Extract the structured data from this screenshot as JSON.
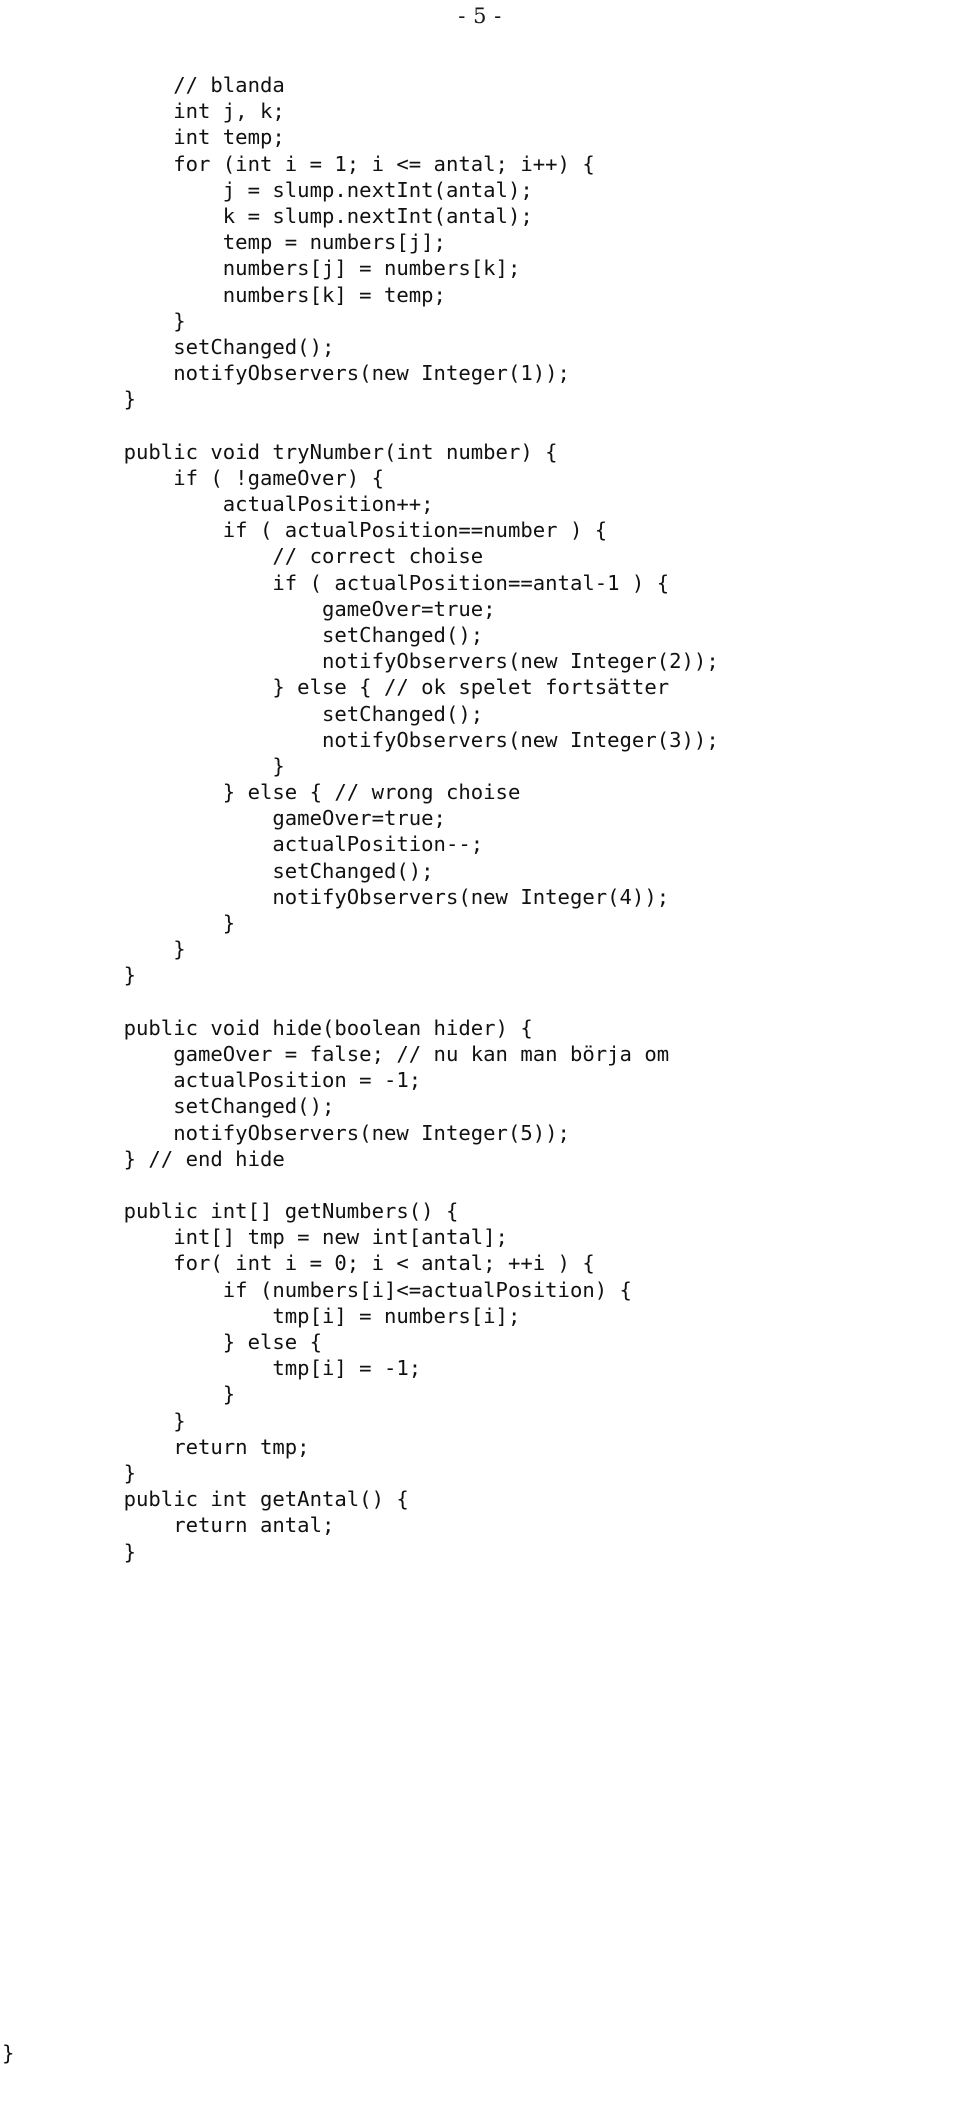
{
  "document": {
    "page_header": "- 5 -",
    "language": "java",
    "final_brace": "}"
  },
  "code": {
    "lines": [
      "        // blanda",
      "        int j, k;",
      "        int temp;",
      "        for (int i = 1; i <= antal; i++) {",
      "            j = slump.nextInt(antal);",
      "            k = slump.nextInt(antal);",
      "            temp = numbers[j];",
      "            numbers[j] = numbers[k];",
      "            numbers[k] = temp;",
      "        }",
      "        setChanged();",
      "        notifyObservers(new Integer(1));",
      "    }",
      "",
      "    public void tryNumber(int number) {",
      "        if ( !gameOver) {",
      "            actualPosition++;",
      "            if ( actualPosition==number ) {",
      "                // correct choise",
      "                if ( actualPosition==antal-1 ) {",
      "                    gameOver=true;",
      "                    setChanged();",
      "                    notifyObservers(new Integer(2));",
      "                } else { // ok spelet fortsätter",
      "                    setChanged();",
      "                    notifyObservers(new Integer(3));",
      "                }",
      "            } else { // wrong choise",
      "                gameOver=true;",
      "                actualPosition--;",
      "                setChanged();",
      "                notifyObservers(new Integer(4));",
      "            }",
      "        }",
      "    }",
      "",
      "    public void hide(boolean hider) {",
      "        gameOver = false; // nu kan man börja om",
      "        actualPosition = -1;",
      "        setChanged();",
      "        notifyObservers(new Integer(5));",
      "    } // end hide",
      "",
      "    public int[] getNumbers() {",
      "        int[] tmp = new int[antal];",
      "        for( int i = 0; i < antal; ++i ) {",
      "            if (numbers[i]<=actualPosition) {",
      "                tmp[i] = numbers[i];",
      "            } else {",
      "                tmp[i] = -1;",
      "            }",
      "        }",
      "        return tmp;",
      "    }",
      "    public int getAntal() {",
      "        return antal;",
      "    }"
    ]
  }
}
